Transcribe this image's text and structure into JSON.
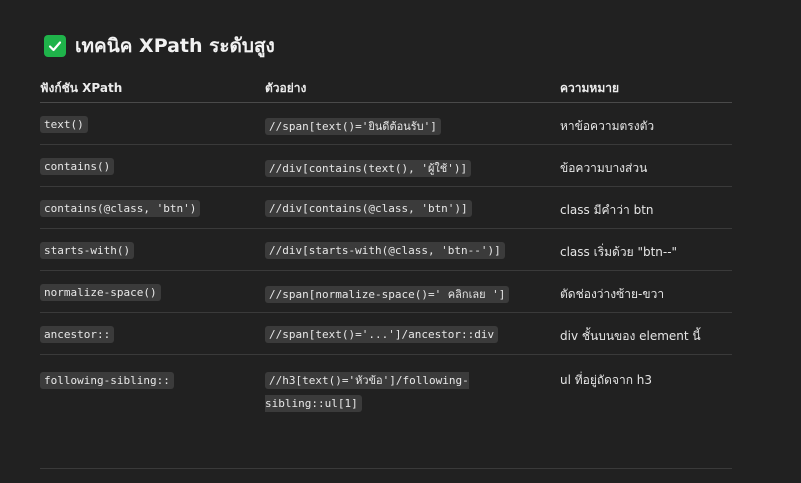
{
  "heading": {
    "icon": "check-mark-icon",
    "accent": "#1fb34a",
    "title": "เทคนิค XPath ระดับสูง"
  },
  "table": {
    "headers": [
      "ฟังก์ชัน XPath",
      "ตัวอย่าง",
      "ความหมาย"
    ],
    "rows": [
      {
        "func": "text()",
        "example": "//span[text()='ยินดีต้อนรับ']",
        "meaning": "หาข้อความตรงตัว"
      },
      {
        "func": "contains()",
        "example": "//div[contains(text(), 'ผู้ใช้')]",
        "meaning": "ข้อความบางส่วน"
      },
      {
        "func": "contains(@class, 'btn')",
        "example": "//div[contains(@class, 'btn')]",
        "meaning": "class มีคำว่า btn"
      },
      {
        "func": "starts-with()",
        "example": "//div[starts-with(@class, 'btn--')]",
        "meaning": "class เริ่มด้วย \"btn--\""
      },
      {
        "func": "normalize-space()",
        "example": "//span[normalize-space()=' คลิกเลย ']",
        "meaning": "ตัดช่องว่างซ้าย-ขวา"
      },
      {
        "func": "ancestor::",
        "example": "//span[text()='...']/ancestor::div",
        "meaning": "div ชั้นบนของ element นี้"
      },
      {
        "func": "following-sibling::",
        "example": "//h3[text()='หัวข้อ']/following-sibling::ul[1]",
        "meaning": "ul ที่อยู่ถัดจาก h3"
      }
    ]
  }
}
